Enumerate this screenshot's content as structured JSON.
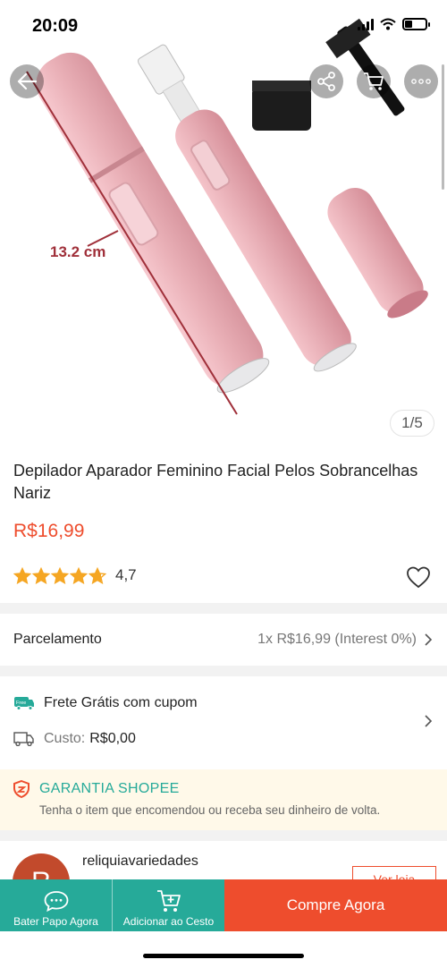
{
  "status_bar": {
    "time": "20:09",
    "battery_level": 0.35
  },
  "product": {
    "image_measurement": "13.2 cm",
    "image_counter": "1/5",
    "title": "Depilador Aparador Feminino Facial Pelos Sobrancelhas Nariz",
    "price": "R$16,99",
    "rating": 4.7,
    "rating_text": "4,7"
  },
  "parcelamento": {
    "label": "Parcelamento",
    "value": "1x R$16,99 (Interest 0%)"
  },
  "shipping": {
    "free_badge": "Free",
    "free_text": "Frete Grátis com cupom",
    "cost_label": "Custo:",
    "cost_value": "R$0,00"
  },
  "guarantee": {
    "title": "GARANTIA SHOPEE",
    "subtitle": "Tenha o item que encomendou ou receba seu dinheiro de volta."
  },
  "shop": {
    "avatar_letter": "R",
    "name": "reliquiavariedades",
    "button": "Ver loja"
  },
  "bottom_bar": {
    "chat_label": "Bater Papo Agora",
    "cart_label": "Adicionar ao Cesto",
    "buy_label": "Compre Agora"
  },
  "colors": {
    "brand": "#ee4d2d",
    "teal": "#26aa99",
    "star": "#f5a623",
    "guarantee_bg": "#fff9e9"
  },
  "icons": [
    "back-arrow-icon",
    "share-icon",
    "cart-icon",
    "more-icon",
    "star-icon",
    "heart-icon",
    "chevron-right-icon",
    "free-shipping-icon",
    "truck-icon",
    "shield-icon",
    "chat-icon",
    "add-to-cart-icon"
  ]
}
